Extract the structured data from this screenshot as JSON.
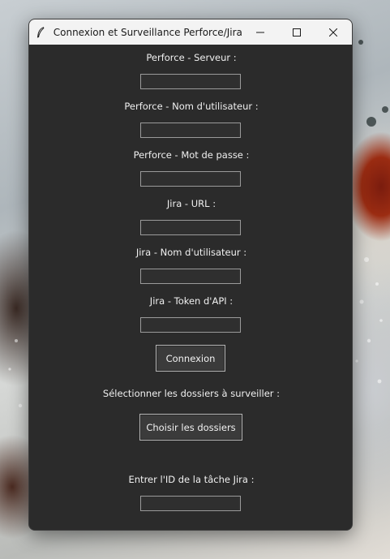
{
  "window": {
    "title": "Connexion et Surveillance Perforce/Jira"
  },
  "form": {
    "p4_server_label": "Perforce - Serveur :",
    "p4_server_value": "",
    "p4_user_label": "Perforce - Nom d'utilisateur :",
    "p4_user_value": "",
    "p4_pass_label": "Perforce - Mot de passe :",
    "p4_pass_value": "",
    "jira_url_label": "Jira - URL :",
    "jira_url_value": "",
    "jira_user_label": "Jira - Nom d'utilisateur :",
    "jira_user_value": "",
    "jira_token_label": "Jira - Token d'API :",
    "jira_token_value": "",
    "connect_button": "Connexion",
    "folders_label": "Sélectionner les dossiers à surveiller :",
    "folders_button": "Choisir les dossiers",
    "task_id_label": "Entrer l'ID de la tâche Jira :",
    "task_id_value": ""
  },
  "icons": {
    "app": "feather-icon",
    "minimize": "minimize-icon",
    "maximize": "maximize-icon",
    "close": "close-icon"
  }
}
